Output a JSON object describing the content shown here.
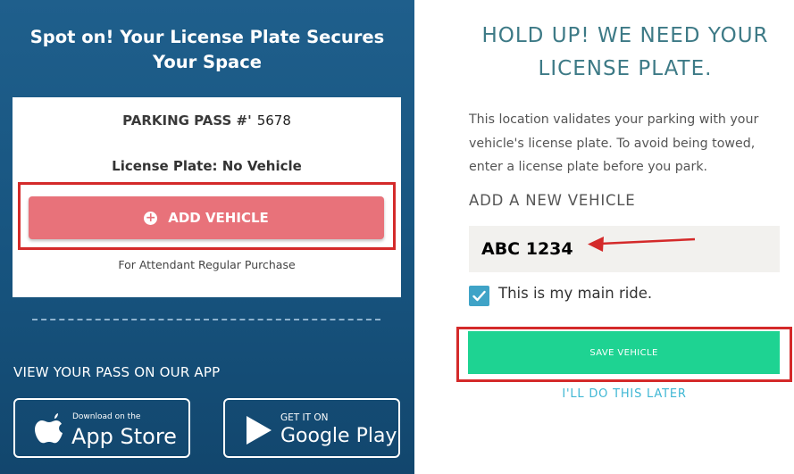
{
  "left": {
    "title": "Spot on! Your License Plate Secures Your Space",
    "pass_label": "PARKING PASS #'",
    "pass_number": "5678",
    "plate_line": "License Plate: No Vehicle",
    "add_vehicle": "ADD VEHICLE",
    "attendant": "For Attendant Regular Purchase",
    "app_heading": "VIEW YOUR PASS ON OUR APP",
    "apple": {
      "small": "Download on the",
      "big": "App Store"
    },
    "google": {
      "small": "GET IT ON",
      "big": "Google Play"
    }
  },
  "right": {
    "title_line1": "HOLD UP! WE NEED YOUR",
    "title_line2": "LICENSE PLATE.",
    "description": "This location validates your parking with your vehicle's license plate. To avoid being towed, enter a license plate before you park.",
    "new_vehicle_label": "ADD A NEW VEHICLE",
    "plate_value": "ABC 1234",
    "main_ride_label": "This is my main ride.",
    "main_ride_checked": true,
    "save_button": "SAVE VEHICLE",
    "later_link": "I'LL DO THIS LATER"
  },
  "colors": {
    "left_bg": "#1a5a87",
    "add_button": "#e8727a",
    "save_button": "#1ed392",
    "highlight": "#d42a2a",
    "title_teal": "#3d7a86",
    "link": "#3fb7d4"
  }
}
